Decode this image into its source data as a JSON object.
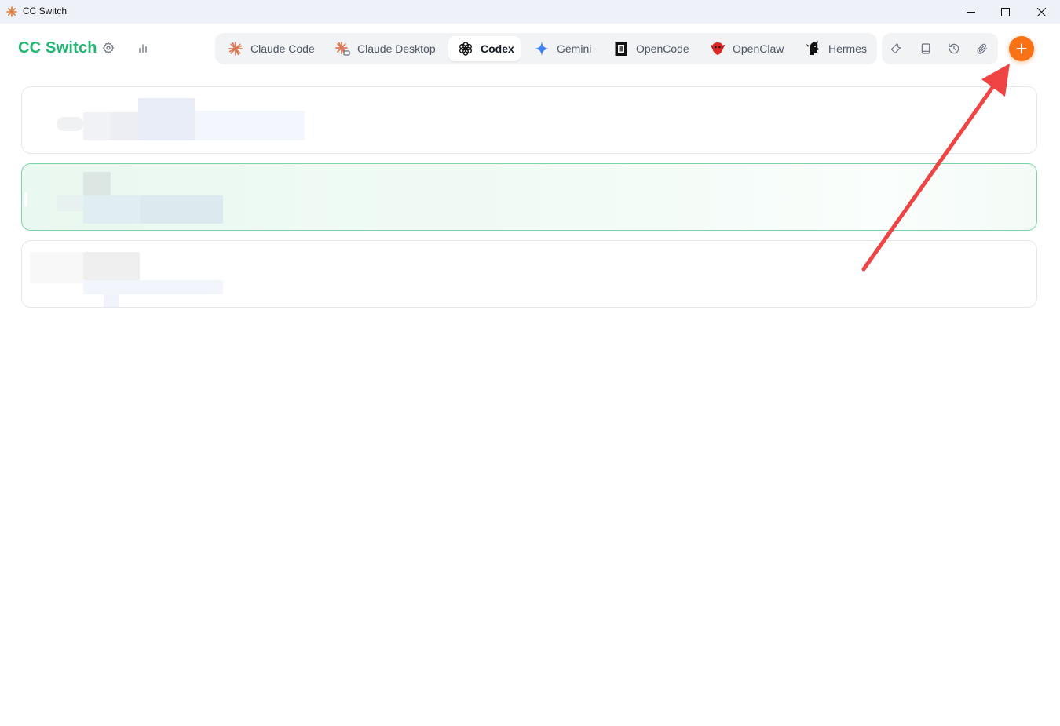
{
  "window": {
    "title": "CC Switch",
    "icon": "cc-switch-sparkle-icon",
    "controls": [
      "minimize-icon",
      "maximize-icon",
      "close-icon"
    ]
  },
  "header": {
    "brand": "CC Switch",
    "brand_color": "#22b573",
    "icons": [
      "gear-icon",
      "bar-chart-icon"
    ]
  },
  "tabs": [
    {
      "label": "Claude Code",
      "icon": "claude-code-icon",
      "active": false
    },
    {
      "label": "Claude Desktop",
      "icon": "claude-desktop-icon",
      "active": false
    },
    {
      "label": "Codex",
      "icon": "openai-codex-icon",
      "active": true
    },
    {
      "label": "Gemini",
      "icon": "gemini-sparkle-icon",
      "active": false
    },
    {
      "label": "OpenCode",
      "icon": "opencode-icon",
      "active": false
    },
    {
      "label": "OpenClaw",
      "icon": "openclaw-icon",
      "active": false
    },
    {
      "label": "Hermes",
      "icon": "hermes-icon",
      "active": false
    }
  ],
  "toolbar": {
    "icons": [
      "wrench-icon",
      "book-icon",
      "history-icon",
      "paperclip-icon"
    ]
  },
  "add_button": {
    "icon": "plus-icon",
    "color": "#f97316"
  },
  "providers": [
    {
      "state": "default",
      "content": "redacted"
    },
    {
      "state": "active",
      "content": "redacted",
      "accent": "#7dd3a8"
    },
    {
      "state": "default",
      "content": "redacted"
    }
  ],
  "annotation": {
    "type": "arrow",
    "color": "#ef4444",
    "points_to": "add-provider-button"
  }
}
